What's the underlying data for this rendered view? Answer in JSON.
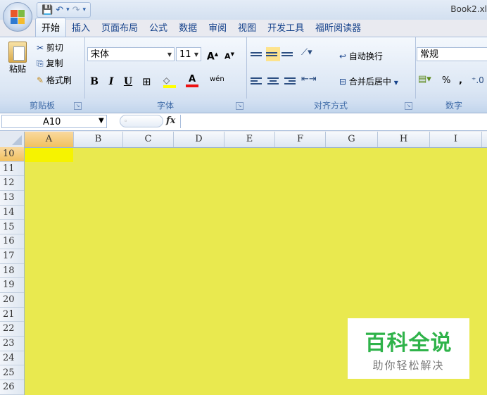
{
  "window": {
    "title": "Book2.xl"
  },
  "quick_access": {
    "save_icon": "save-icon",
    "undo_icon": "undo-icon",
    "redo_icon": "redo-icon",
    "customize_glyph": "▾"
  },
  "tabs": [
    "开始",
    "插入",
    "页面布局",
    "公式",
    "数据",
    "审阅",
    "视图",
    "开发工具",
    "福昕阅读器"
  ],
  "ribbon": {
    "clipboard": {
      "paste": "粘贴",
      "cut": "剪切",
      "copy": "复制",
      "format_painter": "格式刷",
      "label": "剪贴板"
    },
    "font": {
      "name": "宋体",
      "size": "11",
      "grow": "A",
      "shrink": "A",
      "bold": "B",
      "italic": "I",
      "underline": "U",
      "phonetic": "wén",
      "label": "字体"
    },
    "alignment": {
      "wrap": "自动换行",
      "merge": "合并后居中",
      "label": "对齐方式"
    },
    "number": {
      "format": "常规",
      "percent": "%",
      "comma": ",",
      "label": "数字"
    }
  },
  "formula_bar": {
    "name_box": "A10",
    "fx": "fx",
    "value": ""
  },
  "grid": {
    "columns": [
      "A",
      "B",
      "C",
      "D",
      "E",
      "F",
      "G",
      "H",
      "I"
    ],
    "rows": [
      "10",
      "11",
      "12",
      "13",
      "14",
      "15",
      "16",
      "17",
      "18",
      "19",
      "20",
      "21",
      "22",
      "23",
      "24",
      "25",
      "26"
    ],
    "active_cell": "A10",
    "fill_color": "#E9E94F"
  },
  "watermark": {
    "title": "百科全说",
    "subtitle": "助你轻松解决"
  },
  "colors": {
    "fill": "#E9E94F",
    "active": "#F6F300",
    "ribbon_text": "#15428B",
    "watermark_green": "#2FB34A"
  }
}
